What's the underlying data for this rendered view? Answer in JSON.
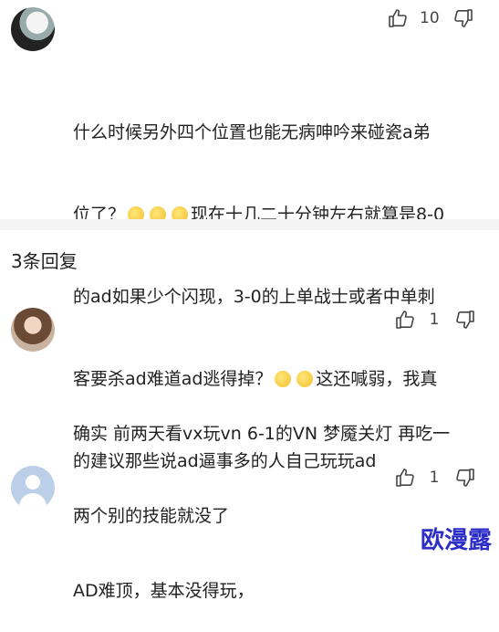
{
  "comment_main": {
    "likes": "10",
    "text_line1": "什么时候另外四个位置也能无病呻吟来碰瓷a弟",
    "text_line2_a": "位了？",
    "text_line2_b": "现在十几二十分钟左右就算是8-0",
    "text_line3": "的ad如果少个闪现，3-0的上单战士或者中单刺",
    "text_line4_a": "客要杀ad难道ad逃得掉？",
    "text_line4_b": "这还喊弱，我真",
    "text_line5": "的建议那些说ad逼事多的人自己玩玩ad"
  },
  "replies_header": "3条回复",
  "replies": [
    {
      "likes": "1",
      "text_line1": "确实 前两天看vx玩vn 6-1的VN 梦魇关灯 再吃一",
      "text_line2": "两个别的技能就没了"
    },
    {
      "likes": "1",
      "text_line1": "AD难顶，基本没得玩，"
    }
  ],
  "watermark": "欧漫露"
}
